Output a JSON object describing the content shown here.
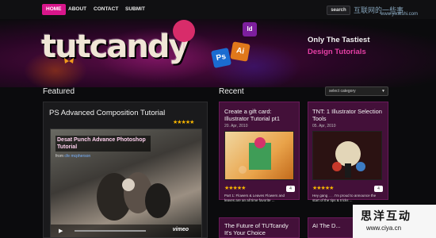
{
  "nav": {
    "items": [
      {
        "label": "HOME",
        "active": true
      },
      {
        "label": "ABOUT",
        "active": false
      },
      {
        "label": "CONTACT",
        "active": false
      },
      {
        "label": "SUBMIT",
        "active": false
      }
    ],
    "search_label": "search"
  },
  "watermark": {
    "top_text": "互联网的一些事",
    "top_url": "www.yixieshi.com",
    "bottom_text": "思洋互动",
    "bottom_url": "www.ciya.cn"
  },
  "header": {
    "logo_text": "tutcandy",
    "badge_ps": "Ps",
    "badge_ai": "Ai",
    "badge_id": "Id",
    "tagline_1": "Only The Tastiest",
    "tagline_2": "Design Tutorials"
  },
  "featured": {
    "heading": "Featured",
    "title": "PS Advanced Composition Tutorial",
    "rating": 4.5,
    "video": {
      "title": "Desat Punch Advance Photoshop Tutorial",
      "from_prefix": "from",
      "author": "cfe mcpherson",
      "player": "vimeo"
    }
  },
  "recent": {
    "heading": "Recent",
    "select_placeholder": "select category",
    "posts": [
      {
        "title": "Create a gift card: Illustrator Tutorial pt1",
        "date": "20. Apr, 2010",
        "rating": 4.5,
        "comments": "4",
        "excerpt": "Part 1: Flowers & Leaves Flowers and leaves are an all time favorite ..."
      },
      {
        "title": "TNT: 1 Illustrator Selection Tools",
        "date": "05. Apr, 2010",
        "rating": 4.5,
        "comments": "4",
        "excerpt": "Hey gang . . . I'm proud to announce the start of the tips & tricks ..."
      },
      {
        "title": "The Future of TUTcandy It's Your Choice",
        "date": "",
        "rating": 0,
        "comments": "",
        "excerpt": ""
      },
      {
        "title": "AI The D...",
        "date": "",
        "rating": 0,
        "comments": "",
        "excerpt": ""
      }
    ]
  },
  "colors": {
    "accent": "#d8168b",
    "post_bg": "#431039",
    "star": "#f7b500"
  }
}
